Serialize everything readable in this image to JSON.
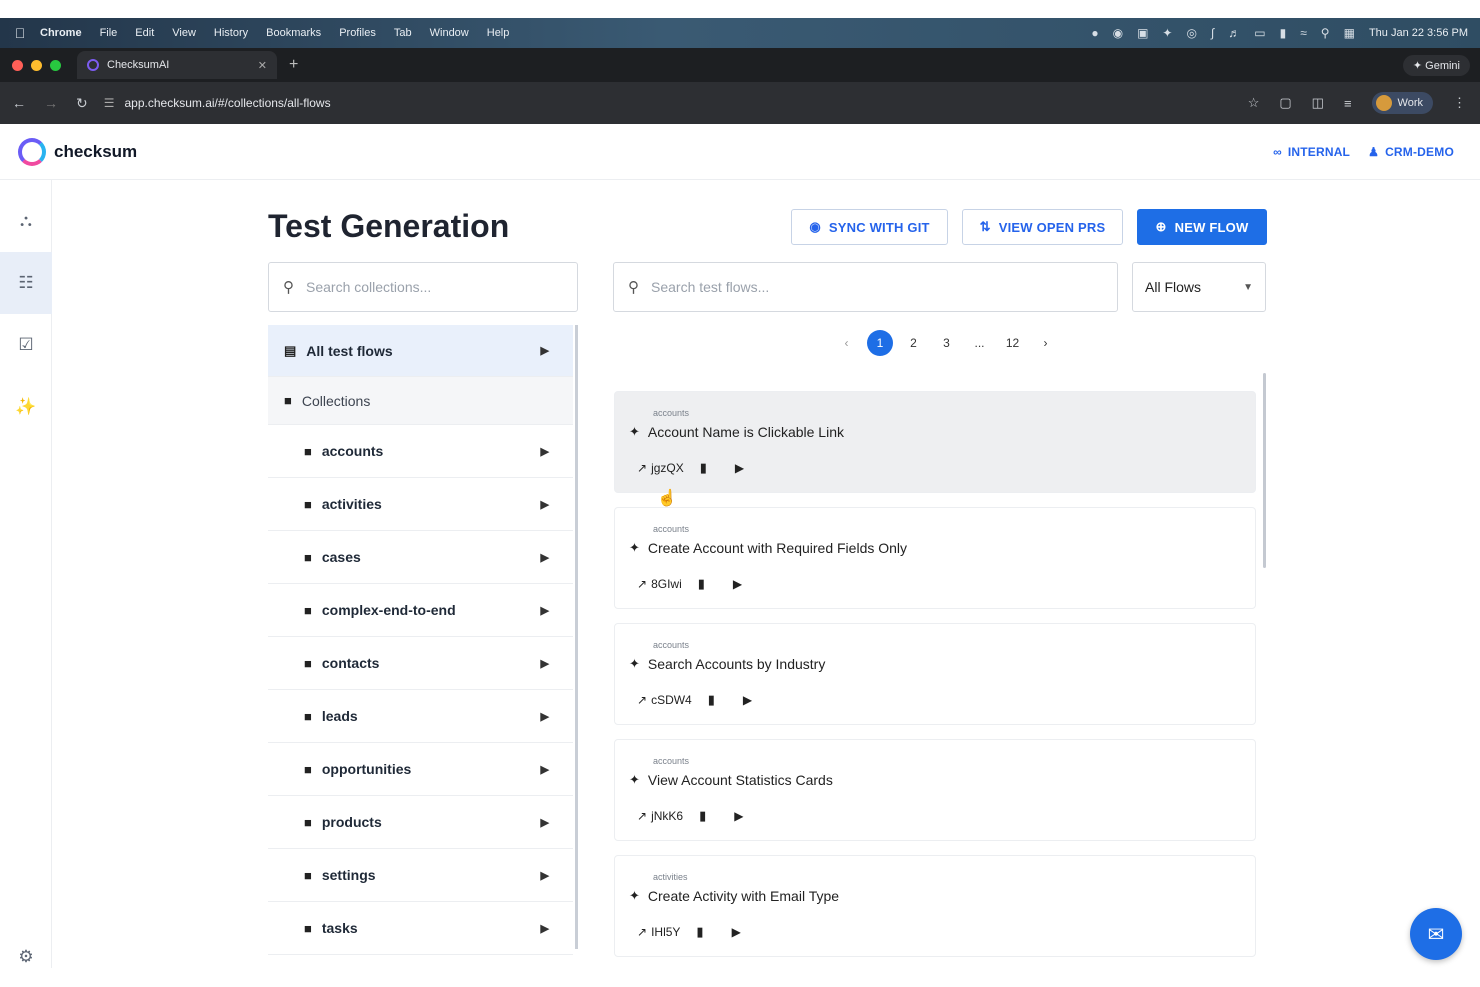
{
  "menubar": {
    "app": "Chrome",
    "items": [
      "File",
      "Edit",
      "View",
      "History",
      "Bookmarks",
      "Profiles",
      "Tab",
      "Window",
      "Help"
    ],
    "clock": "Thu Jan 22  3:56 PM"
  },
  "browser": {
    "tab_title": "ChecksumAI",
    "gemini_label": "Gemini",
    "url": "app.checksum.ai/#/collections/all-flows",
    "profile_label": "Work"
  },
  "app": {
    "logo_text": "checksum",
    "header_links": {
      "internal": "INTERNAL",
      "project": "CRM-DEMO"
    }
  },
  "page": {
    "title": "Test Generation",
    "buttons": {
      "sync": "SYNC WITH GIT",
      "open_prs": "VIEW OPEN PRS",
      "new_flow": "NEW FLOW"
    },
    "search_collections_placeholder": "Search collections...",
    "search_flows_placeholder": "Search test flows...",
    "filter_value": "All Flows"
  },
  "collections": {
    "all_label": "All test flows",
    "header_label": "Collections",
    "items": [
      "accounts",
      "activities",
      "cases",
      "complex-end-to-end",
      "contacts",
      "leads",
      "opportunities",
      "products",
      "settings",
      "tasks"
    ]
  },
  "pagination": {
    "pages": [
      "1",
      "2",
      "3",
      "...",
      "12"
    ],
    "current": "1"
  },
  "flows": [
    {
      "collection": "accounts",
      "name": "Account Name is Clickable Link",
      "id": "jgzQX"
    },
    {
      "collection": "accounts",
      "name": "Create Account with Required Fields Only",
      "id": "8GIwi"
    },
    {
      "collection": "accounts",
      "name": "Search Accounts by Industry",
      "id": "cSDW4"
    },
    {
      "collection": "accounts",
      "name": "View Account Statistics Cards",
      "id": "jNkK6"
    },
    {
      "collection": "activities",
      "name": "Create Activity with Email Type",
      "id": "IHl5Y"
    }
  ],
  "colors": {
    "accent": "#1e6ee6",
    "link": "#2563eb",
    "active_row": "#e9f0fb"
  }
}
